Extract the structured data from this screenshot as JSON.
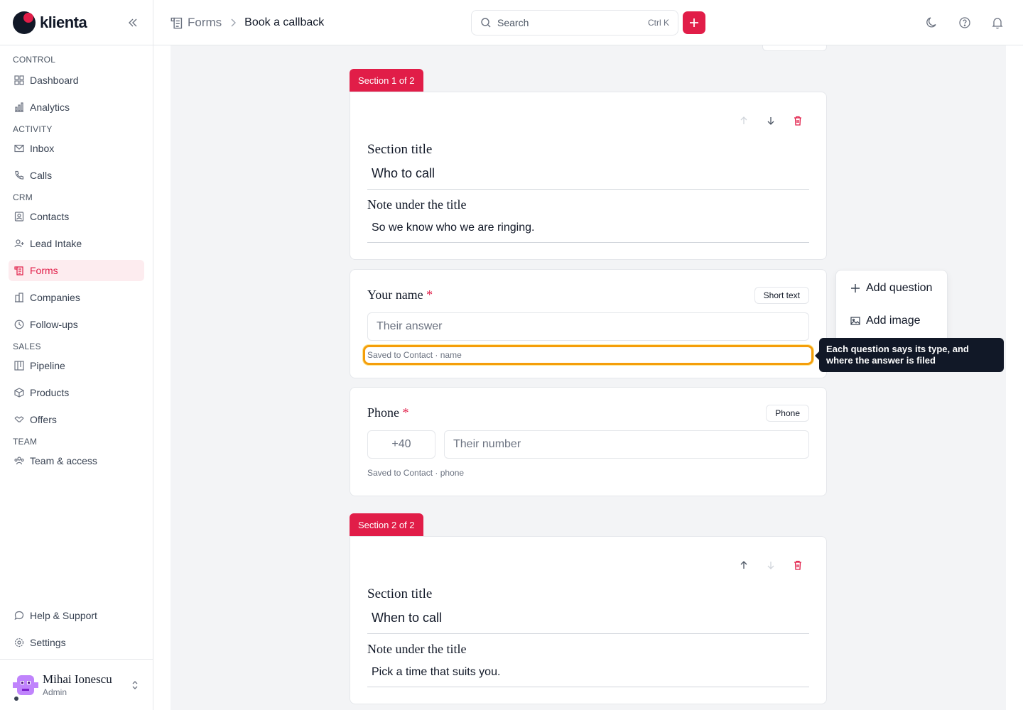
{
  "brand": {
    "name": "klienta",
    "accent": "#e11d48"
  },
  "sidebar": {
    "groups": [
      {
        "label": "CONTROL",
        "items": [
          {
            "label": "Dashboard",
            "icon": "dashboard-icon"
          },
          {
            "label": "Analytics",
            "icon": "analytics-icon"
          }
        ]
      },
      {
        "label": "ACTIVITY",
        "items": [
          {
            "label": "Inbox",
            "icon": "inbox-icon"
          },
          {
            "label": "Calls",
            "icon": "phone-icon"
          }
        ]
      },
      {
        "label": "CRM",
        "items": [
          {
            "label": "Contacts",
            "icon": "contacts-icon"
          },
          {
            "label": "Lead Intake",
            "icon": "lead-intake-icon"
          },
          {
            "label": "Forms",
            "icon": "forms-icon",
            "active": true
          },
          {
            "label": "Companies",
            "icon": "companies-icon"
          },
          {
            "label": "Follow-ups",
            "icon": "clock-icon"
          }
        ]
      },
      {
        "label": "SALES",
        "items": [
          {
            "label": "Pipeline",
            "icon": "pipeline-icon"
          },
          {
            "label": "Products",
            "icon": "box-icon"
          },
          {
            "label": "Offers",
            "icon": "handshake-icon"
          }
        ]
      },
      {
        "label": "TEAM",
        "items": [
          {
            "label": "Team & access",
            "icon": "team-icon"
          }
        ]
      }
    ],
    "bottom": [
      {
        "label": "Help & Support",
        "icon": "chat-icon"
      },
      {
        "label": "Settings",
        "icon": "gear-icon"
      }
    ],
    "user": {
      "name": "Mihai Ionescu",
      "role": "Admin"
    }
  },
  "topbar": {
    "breadcrumb": {
      "parent": "Forms",
      "current": "Book a callback"
    },
    "search": {
      "placeholder": "Search",
      "shortcut": "Ctrl K"
    }
  },
  "form": {
    "sections": [
      {
        "tab": "Section 1 of 2",
        "title_label": "Section title",
        "title_value": "Who to call",
        "note_label": "Note under the title",
        "note_value": "So we know who we are ringing."
      },
      {
        "tab": "Section 2 of 2",
        "title_label": "Section title",
        "title_value": "When to call",
        "note_label": "Note under the title",
        "note_value": "Pick a time that suits you."
      }
    ],
    "questions": [
      {
        "label": "Your name",
        "required": "*",
        "type": "Short text",
        "placeholder": "Their answer",
        "saved": "Saved to Contact · name"
      },
      {
        "label": "Phone",
        "required": "*",
        "type": "Phone",
        "prefix": "+40",
        "placeholder": "Their number",
        "saved": "Saved to Contact · phone"
      }
    ]
  },
  "side_menu": {
    "add_question": "Add question",
    "add_image": "Add image"
  },
  "tooltip": {
    "text": "Each question says its type, and where the answer is filed"
  }
}
